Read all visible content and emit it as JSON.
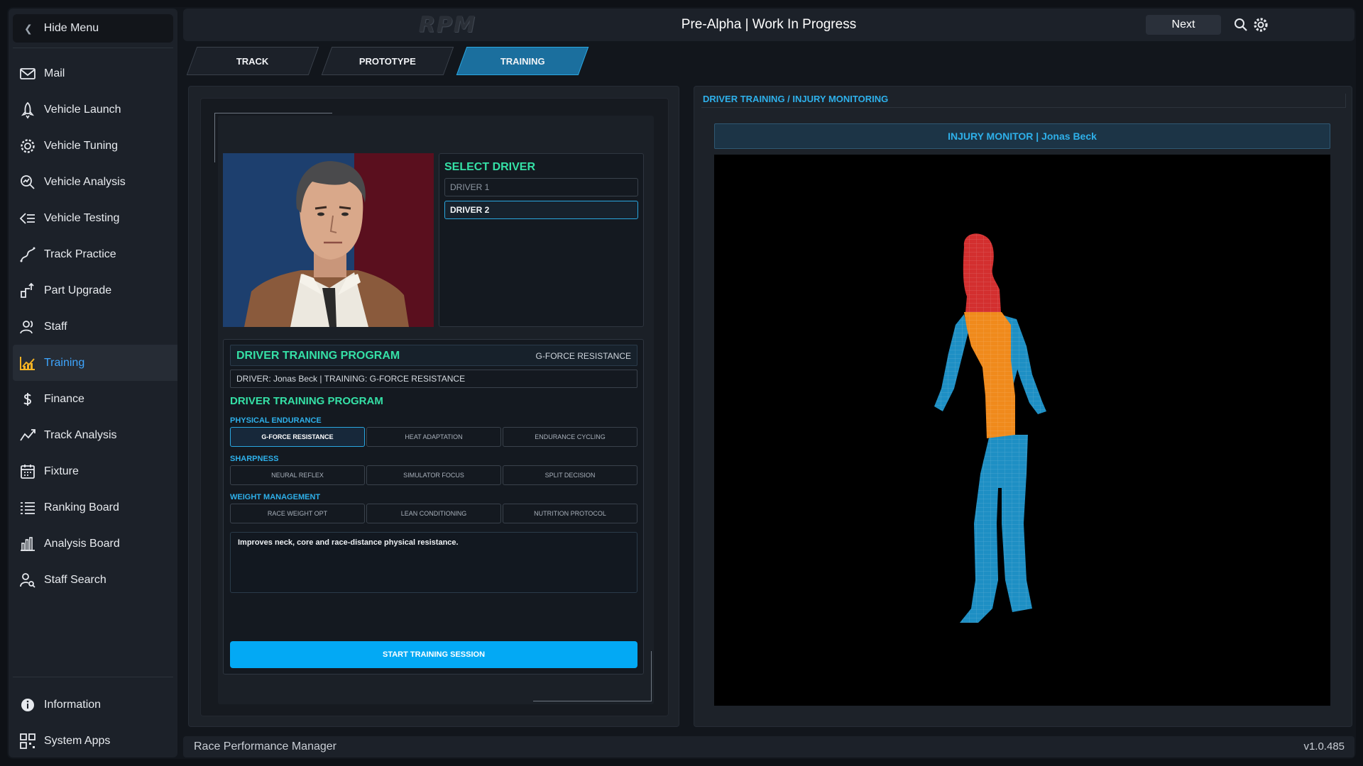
{
  "sidebar": {
    "hide_menu": "Hide Menu",
    "items": [
      {
        "label": "Mail",
        "icon": "mail-icon"
      },
      {
        "label": "Vehicle Launch",
        "icon": "rocket-icon"
      },
      {
        "label": "Vehicle Tuning",
        "icon": "gear-icon"
      },
      {
        "label": "Vehicle Analysis",
        "icon": "magnify-chart-icon"
      },
      {
        "label": "Vehicle Testing",
        "icon": "list-arrow-icon"
      },
      {
        "label": "Track Practice",
        "icon": "track-path-icon"
      },
      {
        "label": "Part Upgrade",
        "icon": "upgrade-icon"
      },
      {
        "label": "Staff",
        "icon": "staff-icon"
      },
      {
        "label": "Training",
        "icon": "training-chart-icon",
        "active": true
      },
      {
        "label": "Finance",
        "icon": "dollar-icon"
      },
      {
        "label": "Track Analysis",
        "icon": "line-chart-icon"
      },
      {
        "label": "Fixture",
        "icon": "calendar-icon"
      },
      {
        "label": "Ranking Board",
        "icon": "ranking-list-icon"
      },
      {
        "label": "Analysis Board",
        "icon": "bar-chart-icon"
      },
      {
        "label": "Staff Search",
        "icon": "user-search-icon"
      }
    ],
    "bottom": [
      {
        "label": "Information",
        "icon": "info-icon"
      },
      {
        "label": "System Apps",
        "icon": "apps-icon"
      }
    ],
    "accent_color": "#3ea6ff"
  },
  "header": {
    "logo": "RPM",
    "title": "Pre-Alpha | Work In Progress",
    "next_label": "Next"
  },
  "tabs": [
    {
      "label": "TRACK"
    },
    {
      "label": "PROTOTYPE"
    },
    {
      "label": "TRAINING",
      "active": true
    }
  ],
  "select_driver": {
    "title": "SELECT DRIVER",
    "drivers": [
      "DRIVER 1",
      "DRIVER 2"
    ],
    "selected": "DRIVER 2"
  },
  "program": {
    "head_title": "DRIVER TRAINING PROGRAM",
    "head_right": "G-FORCE RESISTANCE",
    "sub": "DRIVER: Jonas Beck  |  TRAINING: G-FORCE RESISTANCE",
    "section_title": "DRIVER TRAINING PROGRAM",
    "categories": [
      {
        "name": "PHYSICAL ENDURANCE",
        "options": [
          "G-FORCE RESISTANCE",
          "HEAT ADAPTATION",
          "ENDURANCE CYCLING"
        ]
      },
      {
        "name": "SHARPNESS",
        "options": [
          "NEURAL REFLEX",
          "SIMULATOR FOCUS",
          "SPLIT DECISION"
        ]
      },
      {
        "name": "WEIGHT MANAGEMENT",
        "options": [
          "RACE WEIGHT OPT",
          "LEAN CONDITIONING",
          "NUTRITION PROTOCOL"
        ]
      }
    ],
    "selected_option": "G-FORCE RESISTANCE",
    "description": "Improves neck, core and race-distance physical resistance.",
    "start_label": "START TRAINING SESSION",
    "accent_green": "#35e0a6",
    "accent_blue": "#2eb0ea"
  },
  "injury": {
    "panel_title": "DRIVER TRAINING / INJURY MONITORING",
    "monitor_label": "INJURY MONITOR | Jonas Beck",
    "zone_colors": {
      "head": "#d32f2f",
      "torso": "#f08a1c",
      "limbs": "#1e8fc4"
    }
  },
  "footer": {
    "app_name": "Race Performance Manager",
    "version": "v1.0.485"
  }
}
